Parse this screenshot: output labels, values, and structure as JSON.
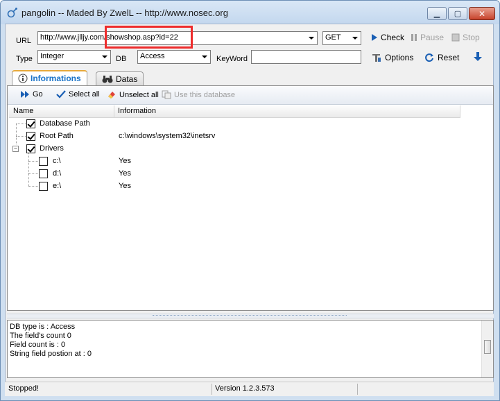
{
  "window": {
    "title": "pangolin -- Maded By ZwelL -- http://www.nosec.org"
  },
  "form": {
    "url_label": "URL",
    "url_value": "http://www.jlljy.com/showshop.asp?id=22",
    "method": "GET",
    "type_label": "Type",
    "type_value": "Integer",
    "db_label": "DB",
    "db_value": "Access",
    "keyword_label": "KeyWord",
    "keyword_value": ""
  },
  "actions": {
    "check": "Check",
    "pause": "Pause",
    "stop": "Stop",
    "options": "Options",
    "reset": "Reset"
  },
  "tabs": [
    {
      "label": "Informations",
      "active": true
    },
    {
      "label": "Datas",
      "active": false
    }
  ],
  "panel_toolbar": {
    "go": "Go",
    "select_all": "Select all",
    "unselect_all": "Unselect all",
    "use_db": "Use this database"
  },
  "list": {
    "columns": [
      "Name",
      "Information"
    ],
    "rows": [
      {
        "name": "Database Path",
        "info": "",
        "checked": true,
        "level": 0
      },
      {
        "name": "Root Path",
        "info": "c:\\windows\\system32\\inetsrv",
        "checked": true,
        "level": 0
      },
      {
        "name": "Drivers",
        "info": "",
        "checked": true,
        "level": 0
      },
      {
        "name": "c:\\",
        "info": "Yes",
        "checked": false,
        "level": 1
      },
      {
        "name": "d:\\",
        "info": "Yes",
        "checked": false,
        "level": 1
      },
      {
        "name": "e:\\",
        "info": "Yes",
        "checked": false,
        "level": 1
      }
    ]
  },
  "log": [
    "DB type is : Access",
    "The field's count 0",
    "Field count is : 0",
    "String field postion at : 0"
  ],
  "status": {
    "state": "Stopped!",
    "version": "Version  1.2.3.573"
  },
  "colors": {
    "highlight": "#ee2b2b",
    "active_tab": "#1a73c8",
    "accent_icon": "#1a5fb4"
  }
}
